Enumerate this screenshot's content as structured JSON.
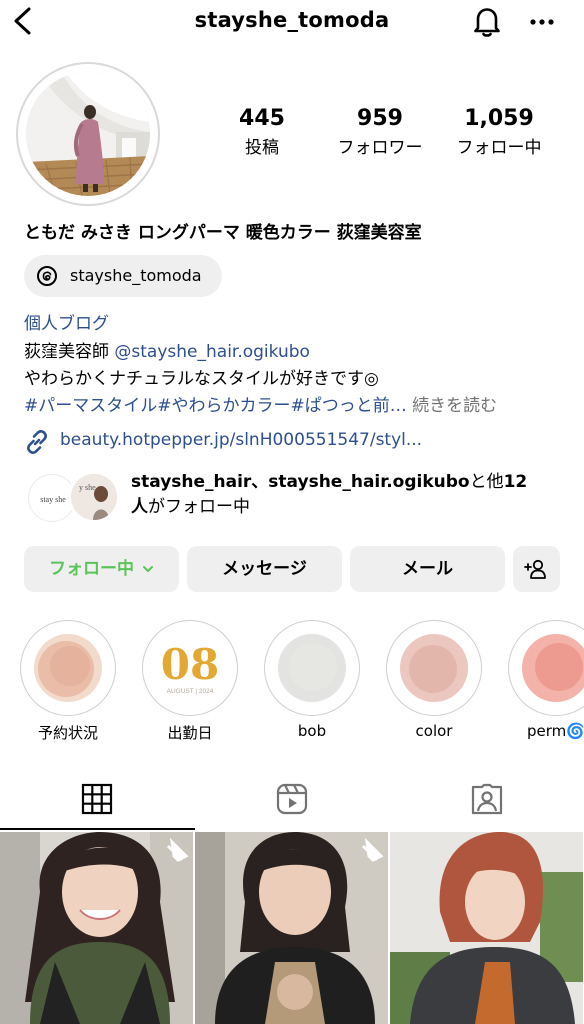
{
  "header": {
    "username": "stayshe_tomoda",
    "back_icon": "chevron-left-icon",
    "notification_icon": "bell-icon",
    "more_icon": "more-horizontal-icon"
  },
  "stats": [
    {
      "value": "445",
      "label": "投稿"
    },
    {
      "value": "959",
      "label": "フォロワー"
    },
    {
      "value": "1,059",
      "label": "フォロー中"
    }
  ],
  "profile": {
    "name": "ともだ みさき ロングパーマ 暖色カラー 荻窪美容室",
    "threads_handle": "stayshe_tomoda",
    "category": "個人ブログ",
    "bio_prefix": "荻窪美容師 ",
    "bio_mention": "@stayshe_hair.ogikubo",
    "bio_line2": "やわらかくナチュラルなスタイルが好きです◎",
    "bio_hashtags": "#パーマスタイル#やわらかカラー#ぱつっと前…",
    "more_label": "続きを読む",
    "link": "beauty.hotpepper.jp/slnH000551547/styl..."
  },
  "followed_by": {
    "text_bold": "stayshe_hair、stayshe_hair.ogikubo",
    "text_mid": "と他",
    "count": "12",
    "text_line2_bold": "人",
    "text_line2_rest": "がフォロー中",
    "avatar1_text": "stay she",
    "avatar2_text": "y she"
  },
  "buttons": {
    "following": "フォロー中",
    "message": "メッセージ",
    "email": "メール"
  },
  "highlights": [
    {
      "label": "予約状況",
      "color": "#e8bba4"
    },
    {
      "label": "出勤日",
      "number": "08",
      "subtitle": "AUGUST | 2024",
      "color": "#e4a832"
    },
    {
      "label": "bob",
      "color": "#dcdcda"
    },
    {
      "label": "color",
      "color": "#e5b4aa"
    },
    {
      "label": "perm",
      "emoji": "🌀",
      "color": "#ef9a8e"
    }
  ],
  "tabs": [
    {
      "name": "grid-icon",
      "active": true
    },
    {
      "name": "reels-icon",
      "active": false
    },
    {
      "name": "tagged-icon",
      "active": false
    }
  ],
  "colors": {
    "link_blue": "#2d4f8e",
    "follow_green": "#5ac458",
    "button_bg": "#efefef"
  }
}
